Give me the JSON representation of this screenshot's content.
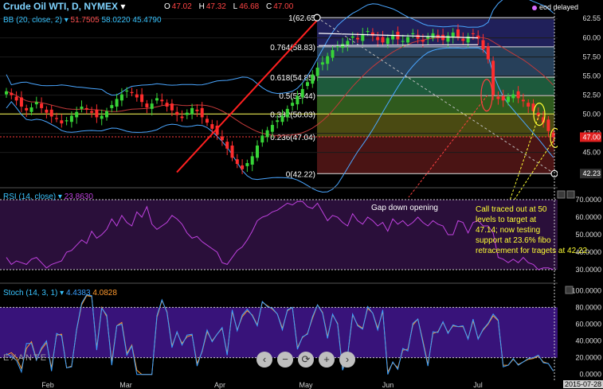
{
  "header": {
    "symbol": "Crude Oil WTI, D, NYMEX",
    "dropdown_glyph": "▾",
    "ohlc": [
      {
        "label": "O",
        "value": "47.02"
      },
      {
        "label": "H",
        "value": "47.32"
      },
      {
        "label": "L",
        "value": "46.68"
      },
      {
        "label": "C",
        "value": "47.00"
      }
    ],
    "eod": "eod delayed"
  },
  "bb": {
    "label": "BB (20, close, 2)",
    "v1": "51.7505",
    "v2": "58.0220",
    "v3": "45.4790"
  },
  "rsi": {
    "label": "RSI (14, close)",
    "value": "23.8630"
  },
  "stoch": {
    "label": "Stoch (14, 3, 1)",
    "k": "4.4383",
    "d": "4.0828"
  },
  "annotations": {
    "gap": "Gap down opening",
    "call": [
      "Call traced out at 50",
      "levels to target at",
      "47.14; now testing",
      "support at  23.6% fibo",
      "retracement for tragets at 42.22."
    ]
  },
  "fib_levels": [
    {
      "label": "1(62.65",
      "value": 62.65
    },
    {
      "label": "0.764(58.83)",
      "value": 58.83
    },
    {
      "label": "0.618(54.85)",
      "value": 54.85
    },
    {
      "label": "0.5(52.44)",
      "value": 52.44
    },
    {
      "label": "0.382(50.03)",
      "value": 50.03
    },
    {
      "label": "0.236(47.04)",
      "value": 47.04
    },
    {
      "label": "0(42.22)",
      "value": 42.22
    }
  ],
  "price_axis": [
    "62.55",
    "60.00",
    "57.50",
    "55.00",
    "52.50",
    "50.00",
    "47.50",
    "45.00",
    "42.23"
  ],
  "price_tags": {
    "last": "47.00",
    "low": "42.23"
  },
  "rsi_axis": [
    "70.0000",
    "60.0000",
    "50.0000",
    "40.0000",
    "30.0000"
  ],
  "stoch_axis": [
    "100.0000",
    "80.0000",
    "60.0000",
    "40.0000",
    "20.0000",
    "0.0000"
  ],
  "months": [
    "Feb",
    "Mar",
    "Apr",
    "May",
    "Jun",
    "Jul"
  ],
  "date_label": "2015-07-28",
  "nav_buttons": [
    "‹",
    "−",
    "⟳",
    "+",
    "›"
  ],
  "logo": "EXANTE",
  "colors": {
    "bull": "#37d437",
    "bear": "#ff2d2d",
    "bb": "#4aa6ff",
    "rsi": "#c042e0",
    "stoch_k": "#3aa0ff",
    "stoch_d": "#ff9a2e"
  },
  "chart_data": {
    "type": "candlestick",
    "title": "Crude Oil WTI, D, NYMEX",
    "ylim": [
      41,
      63.5
    ],
    "last_close": 47.0,
    "closes": [
      53.0,
      52.5,
      51.8,
      51.0,
      50.5,
      50.9,
      51.6,
      50.8,
      50.2,
      49.7,
      49.4,
      48.8,
      49.2,
      49.8,
      50.3,
      51.0,
      50.6,
      50.2,
      49.6,
      49.8,
      50.4,
      51.2,
      52.0,
      52.6,
      53.1,
      52.8,
      52.2,
      51.6,
      50.9,
      51.4,
      52.1,
      51.7,
      51.0,
      50.5,
      49.9,
      49.5,
      50.2,
      50.8,
      50.4,
      49.6,
      48.9,
      48.1,
      47.3,
      46.6,
      45.5,
      44.3,
      43.5,
      42.8,
      43.6,
      44.5,
      45.9,
      47.2,
      47.9,
      48.6,
      49.2,
      49.8,
      50.7,
      51.5,
      52.4,
      53.3,
      54.2,
      55.2,
      56.1,
      56.8,
      57.6,
      58.4,
      58.9,
      59.2,
      59.6,
      60.2,
      59.8,
      60.5,
      60.9,
      60.3,
      59.7,
      59.4,
      60.0,
      60.4,
      59.8,
      59.6,
      60.1,
      60.6,
      59.9,
      59.5,
      60.2,
      60.6,
      60.0,
      59.7,
      60.3,
      60.7,
      60.1,
      59.6,
      60.2,
      60.5,
      59.9,
      58.5,
      57.2,
      52.5,
      52.0,
      51.8,
      52.3,
      52.6,
      52.1,
      51.7,
      51.0,
      50.4,
      49.8,
      48.9,
      47.8,
      47.0
    ],
    "rsi": [
      37,
      33,
      35,
      34,
      33,
      36,
      37,
      34,
      31,
      33,
      34,
      35,
      40,
      41,
      44,
      47,
      45,
      52,
      48,
      50,
      53,
      59,
      55,
      61,
      57,
      55,
      63,
      60,
      66,
      56,
      53,
      55,
      57,
      61,
      59,
      56,
      51,
      48,
      49,
      46,
      44,
      42,
      40,
      34,
      33,
      37,
      41,
      43,
      47,
      52,
      58,
      60,
      61,
      63,
      64,
      66,
      68,
      67,
      69,
      69,
      66,
      65,
      68,
      63,
      58,
      61,
      60,
      57,
      55,
      62,
      58,
      56,
      60,
      58,
      55,
      57,
      52,
      59,
      56,
      58,
      55,
      57,
      60,
      57,
      55,
      58,
      56,
      55,
      50,
      50,
      58,
      57,
      51,
      57,
      58,
      55,
      55,
      51,
      37,
      36,
      34,
      36,
      34,
      37,
      34,
      33,
      30,
      31,
      31,
      30
    ],
    "stoch_k": [
      25,
      21,
      17,
      3,
      37,
      37,
      17,
      32,
      40,
      4,
      49,
      46,
      8,
      9,
      54,
      85,
      95,
      94,
      29,
      79,
      71,
      11,
      58,
      60,
      23,
      34,
      0,
      0,
      0,
      0,
      70,
      89,
      74,
      32,
      51,
      35,
      47,
      48,
      10,
      28,
      53,
      39,
      48,
      56,
      23,
      77,
      52,
      71,
      78,
      70,
      58,
      87,
      81,
      79,
      72,
      53,
      77,
      80,
      30,
      45,
      48,
      69,
      83,
      73,
      43,
      72,
      60,
      5,
      23,
      72,
      58,
      54,
      81,
      73,
      53,
      77,
      0,
      15,
      6,
      31,
      28,
      61,
      66,
      38,
      10,
      51,
      50,
      63,
      49,
      59,
      57,
      58,
      42,
      66,
      42,
      54,
      61,
      72,
      65,
      9,
      11,
      19,
      11,
      15,
      19,
      20,
      23,
      14,
      13,
      4
    ],
    "stoch_d": [
      23,
      26,
      20,
      7,
      31,
      39,
      18,
      30,
      38,
      8,
      47,
      48,
      8,
      10,
      53,
      83,
      94,
      93,
      31,
      80,
      69,
      15,
      58,
      62,
      25,
      35,
      5,
      0,
      0,
      0,
      68,
      88,
      75,
      34,
      50,
      37,
      45,
      47,
      13,
      27,
      51,
      40,
      48,
      55,
      25,
      75,
      53,
      69,
      76,
      71,
      59,
      86,
      82,
      78,
      72,
      55,
      76,
      80,
      32,
      44,
      49,
      67,
      83,
      74,
      45,
      71,
      61,
      7,
      22,
      71,
      59,
      55,
      79,
      73,
      55,
      75,
      3,
      14,
      8,
      29,
      30,
      59,
      66,
      40,
      12,
      49,
      51,
      62,
      50,
      58,
      57,
      57,
      43,
      64,
      43,
      53,
      60,
      70,
      64,
      11,
      11,
      18,
      12,
      15,
      18,
      19,
      22,
      15,
      13,
      4
    ]
  }
}
